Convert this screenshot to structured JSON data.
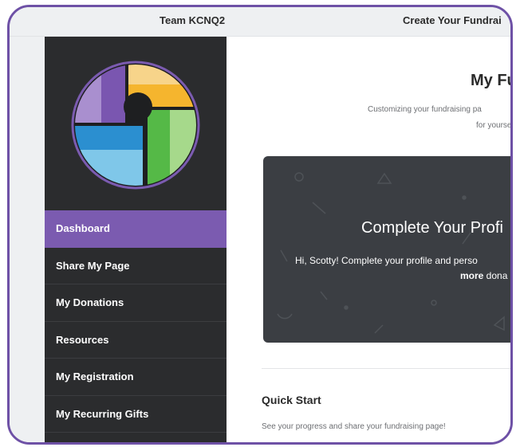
{
  "topbar": {
    "team_name": "Team KCNQ2",
    "create_title": "Create Your Fundrai"
  },
  "sidebar": {
    "items": [
      {
        "label": "Dashboard",
        "active": true
      },
      {
        "label": "Share My Page",
        "active": false
      },
      {
        "label": "My Donations",
        "active": false
      },
      {
        "label": "Resources",
        "active": false
      },
      {
        "label": "My Registration",
        "active": false
      },
      {
        "label": "My Recurring Gifts",
        "active": false
      }
    ]
  },
  "main": {
    "title": "My Fu",
    "subtitle_line1": "Customizing your fundraising pa",
    "subtitle_line2": "for yoursel",
    "profile_card": {
      "title": "Complete Your Profi",
      "line1": "Hi, Scotty! Complete your profile and perso",
      "line2_bold": "more",
      "line2_rest": " dona"
    },
    "quick_start": {
      "title": "Quick Start",
      "subtitle": "See your progress and share your fundraising page!"
    }
  },
  "colors": {
    "accent": "#7b5bb0",
    "frame_border": "#6e51a6",
    "sidebar_bg": "#2b2c2e",
    "card_bg": "#3b3e43"
  }
}
